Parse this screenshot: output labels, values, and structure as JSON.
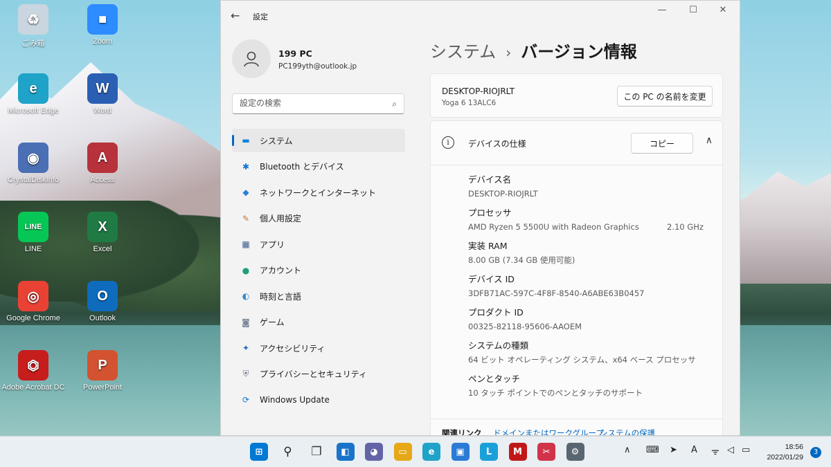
{
  "desktop": {
    "icons": [
      {
        "label": "ごみ箱",
        "icon": "recycle-bin-icon",
        "color": "#c9d6df"
      },
      {
        "label": "Zoom",
        "icon": "zoom-icon",
        "color": "#2d8cff"
      },
      {
        "label": "Microsoft Edge",
        "icon": "edge-icon",
        "color": "#1fa3c9"
      },
      {
        "label": "Word",
        "icon": "word-icon",
        "color": "#2b5fb4"
      },
      {
        "label": "CrystalDiskInfo",
        "icon": "crystaldiskinfo-icon",
        "color": "#4a6fb5"
      },
      {
        "label": "Access",
        "icon": "access-icon",
        "color": "#b7323b"
      },
      {
        "label": "LINE",
        "icon": "line-icon",
        "color": "#06c755"
      },
      {
        "label": "Excel",
        "icon": "excel-icon",
        "color": "#1f7a44"
      },
      {
        "label": "Google Chrome",
        "icon": "chrome-icon",
        "color": "#e94235"
      },
      {
        "label": "Outlook",
        "icon": "outlook-icon",
        "color": "#0f6cbd"
      },
      {
        "label": "Adobe Acrobat DC",
        "icon": "acrobat-icon",
        "color": "#c71d1d"
      },
      {
        "label": "PowerPoint",
        "icon": "powerpoint-icon",
        "color": "#d35230"
      }
    ],
    "glyphs": [
      "♻",
      "■",
      "e",
      "W",
      "◉",
      "A",
      "LINE",
      "X",
      "◎",
      "O",
      "⏣",
      "P"
    ]
  },
  "window": {
    "title": "設定",
    "back_glyph": "←",
    "minimize_glyph": "—",
    "maximize_glyph": "☐",
    "close_glyph": "✕"
  },
  "profile": {
    "name": "199 PC",
    "email": "PC199yth@outlook.jp"
  },
  "search": {
    "placeholder": "設定の検索",
    "icon_glyph": "⌕"
  },
  "nav": {
    "items": [
      {
        "label": "システム",
        "icon": "system-icon",
        "glyph": "▬",
        "color": "#0a84d8",
        "active": true
      },
      {
        "label": "Bluetooth とデバイス",
        "icon": "bluetooth-icon",
        "glyph": "✱",
        "color": "#0a78d4"
      },
      {
        "label": "ネットワークとインターネット",
        "icon": "wifi-icon",
        "glyph": "◆",
        "color": "#2a7fd6"
      },
      {
        "label": "個人用設定",
        "icon": "brush-icon",
        "glyph": "✎",
        "color": "#c0763a"
      },
      {
        "label": "アプリ",
        "icon": "apps-icon",
        "glyph": "▦",
        "color": "#3a5c8a"
      },
      {
        "label": "アカウント",
        "icon": "account-icon",
        "glyph": "●",
        "color": "#1e9e7a"
      },
      {
        "label": "時刻と言語",
        "icon": "globe-clock-icon",
        "glyph": "◐",
        "color": "#2f88c9"
      },
      {
        "label": "ゲーム",
        "icon": "gamepad-icon",
        "glyph": "◙",
        "color": "#7d8a99"
      },
      {
        "label": "アクセシビリティ",
        "icon": "accessibility-icon",
        "glyph": "✦",
        "color": "#1f6fc2"
      },
      {
        "label": "プライバシーとセキュリティ",
        "icon": "shield-icon",
        "glyph": "⛨",
        "color": "#6b7480"
      },
      {
        "label": "Windows Update",
        "icon": "windows-update-icon",
        "glyph": "⟳",
        "color": "#0a78d4"
      }
    ]
  },
  "content": {
    "breadcrumb_parent": "システム",
    "breadcrumb_sep": "›",
    "breadcrumb_current": "バージョン情報",
    "device_name": "DESKTOP-RIOJRLT",
    "device_model": "Yoga 6 13ALC6",
    "rename_button": "この PC の名前を変更",
    "spec_title": "デバイスの仕様",
    "info_glyph": "i",
    "copy_button": "コピー",
    "chevron_glyph": "∧",
    "specs": [
      {
        "label": "デバイス名",
        "value": "DESKTOP-RIOJRLT"
      },
      {
        "label": "プロセッサ",
        "value": "AMD Ryzen 5 5500U with Radeon Graphics           2.10 GHz"
      },
      {
        "label": "実装 RAM",
        "value": "8.00 GB (7.34 GB 使用可能)"
      },
      {
        "label": "デバイス ID",
        "value": "3DFB71AC-597C-4F8F-8540-A6ABE63B0457"
      },
      {
        "label": "プロダクト ID",
        "value": "00325-82118-95606-AAOEM"
      },
      {
        "label": "システムの種類",
        "value": "64 ビット オペレーティング システム、x64 ベース プロセッサ"
      },
      {
        "label": "ペンとタッチ",
        "value": "10 タッチ ポイントでのペンとタッチのサポート"
      }
    ],
    "related_title": "関連リンク",
    "related_links": [
      "ドメインまたはワークグループ",
      "システムの保護"
    ]
  },
  "taskbar": {
    "apps": [
      {
        "icon": "start-icon",
        "glyph": "⊞",
        "color": "#0078d4"
      },
      {
        "icon": "search-icon",
        "glyph": "⚲",
        "color": "#222222"
      },
      {
        "icon": "task-view-icon",
        "glyph": "❐",
        "color": "#333333"
      },
      {
        "icon": "widgets-icon",
        "glyph": "◧",
        "color": "#1a73c9"
      },
      {
        "icon": "teams-chat-icon",
        "glyph": "◕",
        "color": "#6264a7"
      },
      {
        "icon": "file-explorer-icon",
        "glyph": "▭",
        "color": "#e6a817"
      },
      {
        "icon": "edge-icon",
        "glyph": "e",
        "color": "#1fa3c9"
      },
      {
        "icon": "store-icon",
        "glyph": "▣",
        "color": "#2a7bd6"
      },
      {
        "icon": "l-app-icon",
        "glyph": "L",
        "color": "#19a0d8"
      },
      {
        "icon": "mcafee-icon",
        "glyph": "M",
        "color": "#c01818"
      },
      {
        "icon": "snipping-tool-icon",
        "glyph": "✂",
        "color": "#d1344a"
      },
      {
        "icon": "settings-icon",
        "glyph": "⚙",
        "color": "#5a6572"
      }
    ],
    "tray_glyphs": [
      "∧",
      "⌨",
      "➤",
      "A",
      "ᯤ",
      "◁",
      "▭"
    ],
    "time": "18:56",
    "date": "2022/01/29",
    "notification_count": "3"
  }
}
